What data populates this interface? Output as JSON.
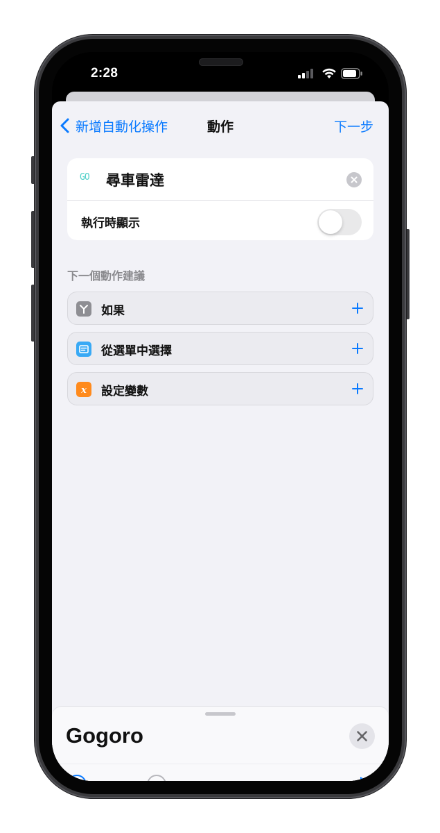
{
  "status_bar": {
    "time": "2:28"
  },
  "nav": {
    "back_label": "新增自動化操作",
    "title": "動作",
    "next_label": "下一步"
  },
  "shortcut": {
    "icon_text": "GO",
    "name": "尋車雷達",
    "show_when_run_label": "執行時顯示",
    "show_when_run": false
  },
  "suggestions": {
    "header": "下一個動作建議",
    "items": [
      {
        "label": "如果",
        "icon": "branch-icon",
        "icon_color": "#8e8e93"
      },
      {
        "label": "從選單中選擇",
        "icon": "menu-list-icon",
        "icon_color": "#38a9f5"
      },
      {
        "label": "設定變數",
        "icon": "variable-x-icon",
        "icon_color": "#ff8a1c"
      }
    ]
  },
  "drawer": {
    "title": "Gogoro"
  },
  "colors": {
    "accent": "#0a7aff",
    "background": "#f2f2f7"
  }
}
